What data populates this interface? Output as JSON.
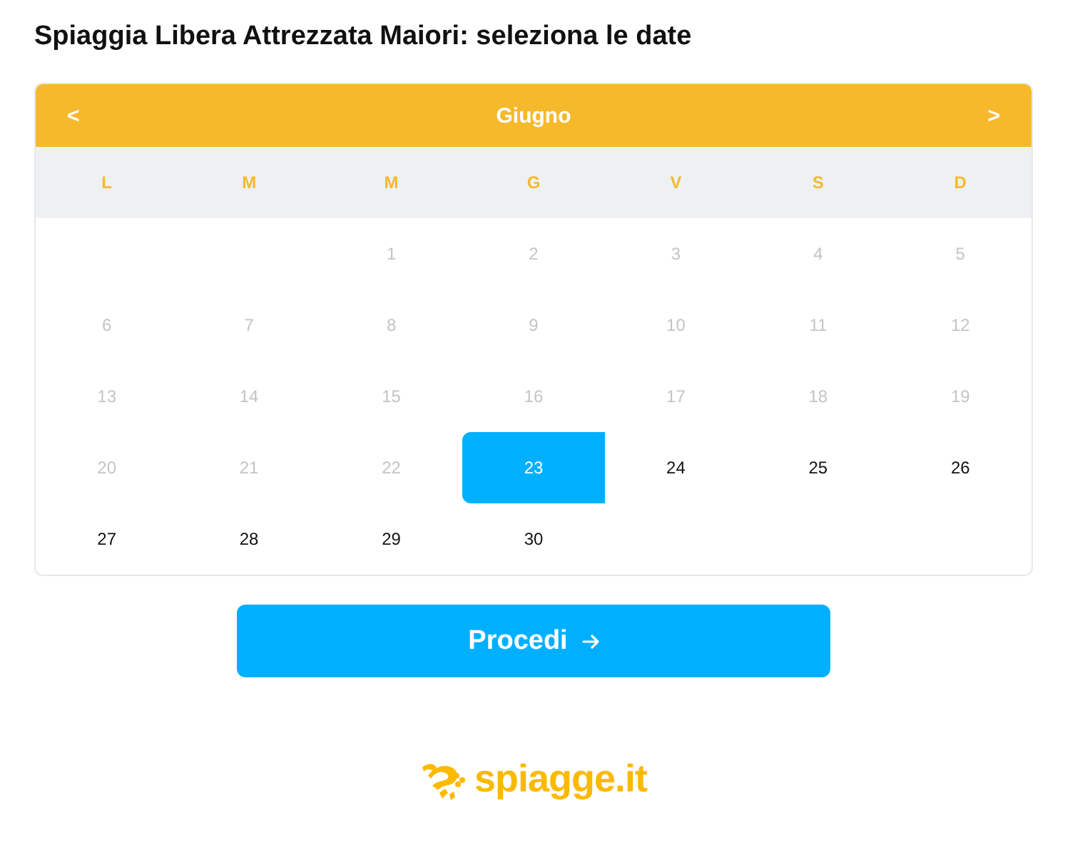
{
  "title": "Spiaggia Libera Attrezzata Maiori: seleziona le date",
  "calendar": {
    "prev": "<",
    "month": "Giugno",
    "next": ">",
    "weekdays": [
      "L",
      "M",
      "M",
      "G",
      "V",
      "S",
      "D"
    ],
    "weeks": [
      [
        {
          "kind": "blank"
        },
        {
          "kind": "blank"
        },
        {
          "kind": "day",
          "label": "1",
          "disabled": true,
          "selected": false
        },
        {
          "kind": "day",
          "label": "2",
          "disabled": true,
          "selected": false
        },
        {
          "kind": "day",
          "label": "3",
          "disabled": true,
          "selected": false
        },
        {
          "kind": "day",
          "label": "4",
          "disabled": true,
          "selected": false
        },
        {
          "kind": "day",
          "label": "5",
          "disabled": true,
          "selected": false
        }
      ],
      [
        {
          "kind": "day",
          "label": "6",
          "disabled": true,
          "selected": false
        },
        {
          "kind": "day",
          "label": "7",
          "disabled": true,
          "selected": false
        },
        {
          "kind": "day",
          "label": "8",
          "disabled": true,
          "selected": false
        },
        {
          "kind": "day",
          "label": "9",
          "disabled": true,
          "selected": false
        },
        {
          "kind": "day",
          "label": "10",
          "disabled": true,
          "selected": false
        },
        {
          "kind": "day",
          "label": "11",
          "disabled": true,
          "selected": false
        },
        {
          "kind": "day",
          "label": "12",
          "disabled": true,
          "selected": false
        }
      ],
      [
        {
          "kind": "day",
          "label": "13",
          "disabled": true,
          "selected": false
        },
        {
          "kind": "day",
          "label": "14",
          "disabled": true,
          "selected": false
        },
        {
          "kind": "day",
          "label": "15",
          "disabled": true,
          "selected": false
        },
        {
          "kind": "day",
          "label": "16",
          "disabled": true,
          "selected": false
        },
        {
          "kind": "day",
          "label": "17",
          "disabled": true,
          "selected": false
        },
        {
          "kind": "day",
          "label": "18",
          "disabled": true,
          "selected": false
        },
        {
          "kind": "day",
          "label": "19",
          "disabled": true,
          "selected": false
        }
      ],
      [
        {
          "kind": "day",
          "label": "20",
          "disabled": true,
          "selected": false
        },
        {
          "kind": "day",
          "label": "21",
          "disabled": true,
          "selected": false
        },
        {
          "kind": "day",
          "label": "22",
          "disabled": true,
          "selected": false
        },
        {
          "kind": "day",
          "label": "23",
          "disabled": false,
          "selected": true
        },
        {
          "kind": "day",
          "label": "24",
          "disabled": false,
          "selected": false
        },
        {
          "kind": "day",
          "label": "25",
          "disabled": false,
          "selected": false
        },
        {
          "kind": "day",
          "label": "26",
          "disabled": false,
          "selected": false
        }
      ],
      [
        {
          "kind": "day",
          "label": "27",
          "disabled": false,
          "selected": false
        },
        {
          "kind": "day",
          "label": "28",
          "disabled": false,
          "selected": false
        },
        {
          "kind": "day",
          "label": "29",
          "disabled": false,
          "selected": false
        },
        {
          "kind": "day",
          "label": "30",
          "disabled": false,
          "selected": false
        },
        {
          "kind": "blank"
        },
        {
          "kind": "blank"
        },
        {
          "kind": "blank"
        }
      ]
    ]
  },
  "button": {
    "label": "Procedi"
  },
  "logo": {
    "text": "spiagge.it"
  }
}
